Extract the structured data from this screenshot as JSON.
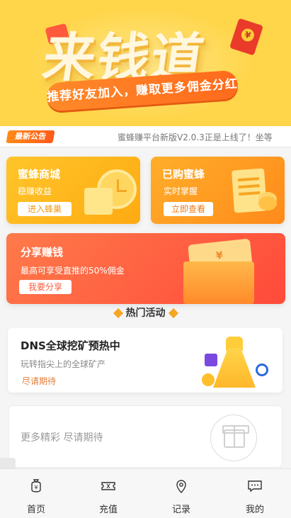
{
  "banner": {
    "title": "来钱道",
    "slogan": "推荐好友加入，赚取更多佣金分红"
  },
  "notice": {
    "badge": "最新公告",
    "text": "蜜蜂赚平台新版V2.0.3正是上线了！坐等"
  },
  "cards": {
    "store": {
      "title": "蜜蜂商城",
      "subtitle": "稳赚收益",
      "button": "进入蜂巢"
    },
    "purchased": {
      "title": "已购蜜蜂",
      "subtitle": "实时掌握",
      "button": "立即查看"
    },
    "share": {
      "title": "分享赚钱",
      "subtitle": "最高可享受直推的50%佣金",
      "button": "我要分享"
    }
  },
  "hot": {
    "title": "热门活动",
    "activity": {
      "title": "DNS全球挖矿预热中",
      "subtitle": "玩转指尖上的全球矿产",
      "status": "尽请期待"
    },
    "more": {
      "text": "更多精彩 尽请期待"
    }
  },
  "tabbar": {
    "items": [
      {
        "label": "首页",
        "icon": "money-bag-icon"
      },
      {
        "label": "充值",
        "icon": "ticket-icon"
      },
      {
        "label": "记录",
        "icon": "location-pin-icon"
      },
      {
        "label": "我的",
        "icon": "chat-bubble-icon"
      }
    ]
  },
  "colors": {
    "banner_bg": "#ffd54a",
    "accent_orange": "#ff8a1a",
    "share_red": "#ff4a3a"
  }
}
